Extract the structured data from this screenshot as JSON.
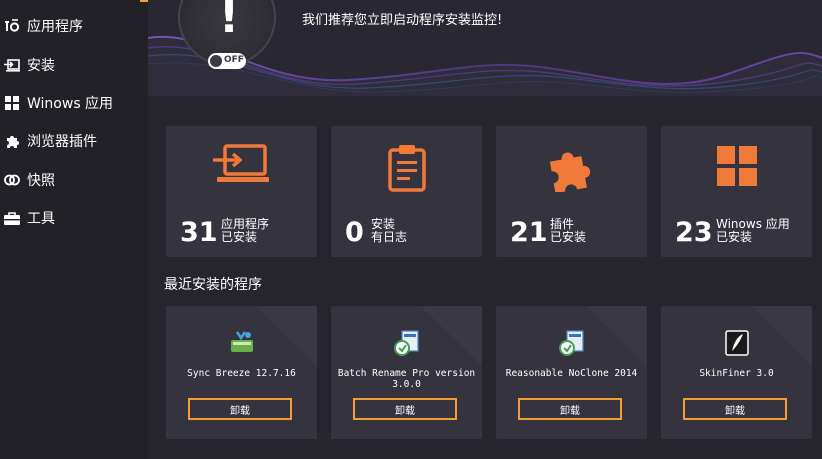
{
  "sidebar": {
    "items": [
      {
        "label": "应用程序",
        "icon": "apps-icon"
      },
      {
        "label": "安装",
        "icon": "install-icon"
      },
      {
        "label": "Winows 应用",
        "icon": "windows-apps-icon"
      },
      {
        "label": "浏览器插件",
        "icon": "puzzle-icon"
      },
      {
        "label": "快照",
        "icon": "snapshot-icon"
      },
      {
        "label": "工具",
        "icon": "toolbox-icon"
      }
    ]
  },
  "header": {
    "alert_mark": "!",
    "toggle_label": "OFF",
    "banner": "我们推荐您立即启动程序安装监控!"
  },
  "stats": [
    {
      "count": "31",
      "line1": "应用程序",
      "line2": "已安装",
      "icon": "laptop-icon"
    },
    {
      "count": "0",
      "line1": "安装",
      "line2": "有日志",
      "icon": "clipboard-icon"
    },
    {
      "count": "21",
      "line1": "插件",
      "line2": "已安装",
      "icon": "puzzle-icon"
    },
    {
      "count": "23",
      "line1": "Winows 应用",
      "line2": "已安装",
      "icon": "windows-grid-icon"
    }
  ],
  "recent": {
    "title": "最近安装的程序",
    "apps": [
      {
        "name": "Sync Breeze 12.7.16",
        "button": "卸载",
        "icon": "sync-breeze-icon"
      },
      {
        "name": "Batch Rename Pro version 3.0.0",
        "button": "卸载",
        "icon": "installer-icon"
      },
      {
        "name": "Reasonable NoClone 2014",
        "button": "卸载",
        "icon": "installer-icon"
      },
      {
        "name": "SkinFiner 3.0",
        "button": "卸载",
        "icon": "skinfiner-icon"
      }
    ]
  },
  "colors": {
    "accent": "#f0a030",
    "icon_orange": "#f07a3a",
    "card": "#35343e",
    "background": "#26252d"
  }
}
